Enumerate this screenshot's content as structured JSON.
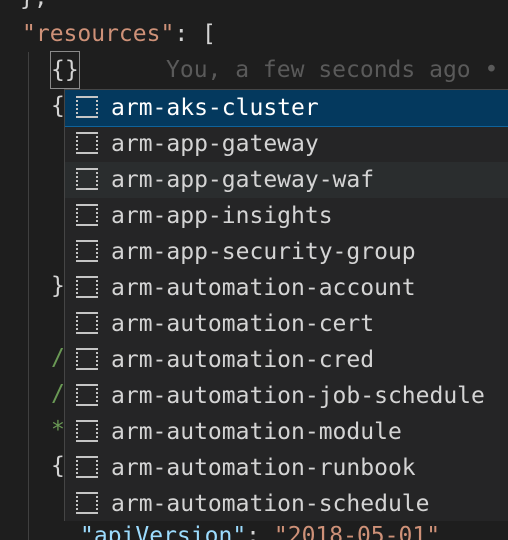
{
  "code": {
    "line0": "},",
    "resources_key": "\"resources\"",
    "resources_rest": ": [",
    "current_brace": "{}",
    "blame_ghost": "You, a few seconds ago •",
    "open_brace": "{",
    "close_brace": "}",
    "slash1": "/",
    "slash2": "/",
    "star": "*",
    "open_brace2": "{",
    "api_key": "\"apiVersion\"",
    "api_colon": ": ",
    "api_value": "\"2018-05-01\""
  },
  "suggestions": {
    "icon": "snippet-icon",
    "selected_index": 0,
    "hover_index": 2,
    "items": [
      {
        "label": "arm-aks-cluster"
      },
      {
        "label": "arm-app-gateway"
      },
      {
        "label": "arm-app-gateway-waf"
      },
      {
        "label": "arm-app-insights"
      },
      {
        "label": "arm-app-security-group"
      },
      {
        "label": "arm-automation-account"
      },
      {
        "label": "arm-automation-cert"
      },
      {
        "label": "arm-automation-cred"
      },
      {
        "label": "arm-automation-job-schedule"
      },
      {
        "label": "arm-automation-module"
      },
      {
        "label": "arm-automation-runbook"
      },
      {
        "label": "arm-automation-schedule"
      }
    ]
  },
  "colors": {
    "editor_bg": "#1e1e1e",
    "widget_bg": "#252526",
    "selected_bg": "#04395e",
    "string": "#ce9178",
    "property": "#9cdcfe",
    "comment": "#6a9955"
  }
}
